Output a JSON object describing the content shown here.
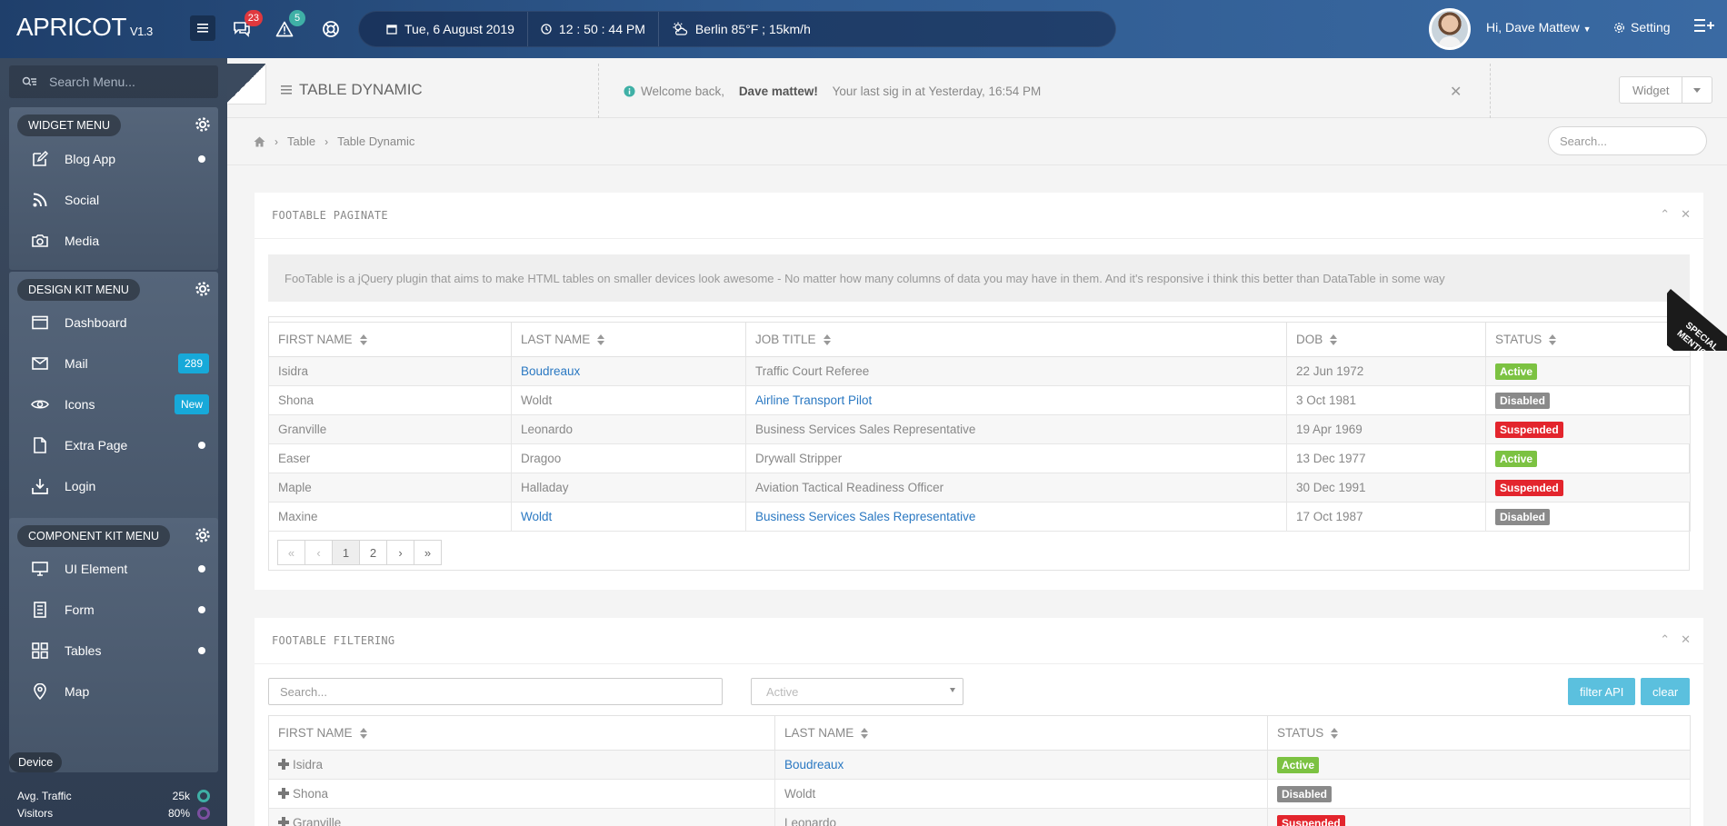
{
  "header": {
    "logo": "APRICOT",
    "version": "V1.3",
    "messages_count": "23",
    "alerts_count": "5",
    "date": "Tue, 6 August 2019",
    "time": "12 : 50 : 44 PM",
    "weather": "Berlin  85°F ; 15km/h",
    "user_greeting": "Hi, Dave Mattew",
    "setting_label": "Setting"
  },
  "sidebar": {
    "search_placeholder": "Search Menu...",
    "widget_menu": {
      "title": "WIDGET MENU",
      "items": [
        {
          "label": "Blog App",
          "icon": "edit-icon"
        },
        {
          "label": "Social",
          "icon": "rss-icon"
        },
        {
          "label": "Media",
          "icon": "camera-icon"
        }
      ]
    },
    "design_menu": {
      "title": "DESIGN KIT MENU",
      "items": [
        {
          "label": "Dashboard",
          "icon": "browser-icon"
        },
        {
          "label": "Mail",
          "icon": "mail-icon",
          "badge": "289"
        },
        {
          "label": "Icons",
          "icon": "eye-icon",
          "badge": "New"
        },
        {
          "label": "Extra Page",
          "icon": "file-icon"
        },
        {
          "label": "Login",
          "icon": "download-icon"
        }
      ]
    },
    "component_menu": {
      "title": "COMPONENT KIT MENU",
      "items": [
        {
          "label": "UI Element",
          "icon": "monitor-icon"
        },
        {
          "label": "Form",
          "icon": "form-icon"
        },
        {
          "label": "Tables",
          "icon": "grid-icon"
        },
        {
          "label": "Map",
          "icon": "pin-icon"
        }
      ]
    },
    "device": {
      "title": "Device",
      "stats": [
        {
          "label": "Avg. Traffic",
          "value": "25k",
          "color": "#3fb0a6"
        },
        {
          "label": "Visitors",
          "value": "80%",
          "color": "#7b4fa0"
        }
      ]
    }
  },
  "pagehead": {
    "title": "TABLE DYNAMIC",
    "welcome_pre": "Welcome back,",
    "welcome_name": "Dave mattew!",
    "welcome_post": "Your last sig in at Yesterday, 16:54 PM",
    "widget_label": "Widget"
  },
  "breadcrumb": {
    "items": [
      "Table",
      "Table Dynamic"
    ],
    "search_placeholder": "Search..."
  },
  "paginate": {
    "title": "FOOTABLE PAGINATE",
    "note": "FooTable is a jQuery plugin that aims to make HTML tables on smaller devices look awesome - No matter how many columns of data you may have in them. And it's responsive i think this better than DataTable in some way",
    "columns": [
      "FIRST NAME",
      "LAST NAME",
      "JOB TITLE",
      "DOB",
      "STATUS"
    ],
    "rows": [
      {
        "first": "Isidra",
        "last": "Boudreaux",
        "job": "Traffic Court Referee",
        "dob": "22 Jun 1972",
        "status": "Active"
      },
      {
        "first": "Shona",
        "last": "Woldt",
        "job": "Airline Transport Pilot",
        "dob": "3 Oct 1981",
        "status": "Disabled"
      },
      {
        "first": "Granville",
        "last": "Leonardo",
        "job": "Business Services Sales Representative",
        "dob": "19 Apr 1969",
        "status": "Suspended"
      },
      {
        "first": "Easer",
        "last": "Dragoo",
        "job": "Drywall Stripper",
        "dob": "13 Dec 1977",
        "status": "Active"
      },
      {
        "first": "Maple",
        "last": "Halladay",
        "job": "Aviation Tactical Readiness Officer",
        "dob": "30 Dec 1991",
        "status": "Suspended"
      },
      {
        "first": "Maxine",
        "last": "Woldt",
        "job": "Business Services Sales Representative",
        "dob": "17 Oct 1987",
        "status": "Disabled"
      }
    ],
    "pager": [
      "«",
      "‹",
      "1",
      "2",
      "›",
      "»"
    ],
    "ribbon_line1": "SPECIAL",
    "ribbon_line2": "MENTION"
  },
  "filtering": {
    "title": "FOOTABLE FILTERING",
    "search_placeholder": "Search...",
    "select_value": "Active",
    "filter_btn": "filter API",
    "clear_btn": "clear",
    "columns": [
      "FIRST NAME",
      "LAST NAME",
      "STATUS"
    ],
    "rows": [
      {
        "first": "Isidra",
        "last": "Boudreaux",
        "status": "Active"
      },
      {
        "first": "Shona",
        "last": "Woldt",
        "status": "Disabled"
      },
      {
        "first": "Granville",
        "last": "Leonardo",
        "status": "Suspended"
      }
    ]
  },
  "colors": {
    "active": "#7cc242",
    "disabled": "#8a8a8a",
    "suspended": "#e3252d",
    "link": "#2a78c2",
    "accent": "#5bc0de"
  }
}
